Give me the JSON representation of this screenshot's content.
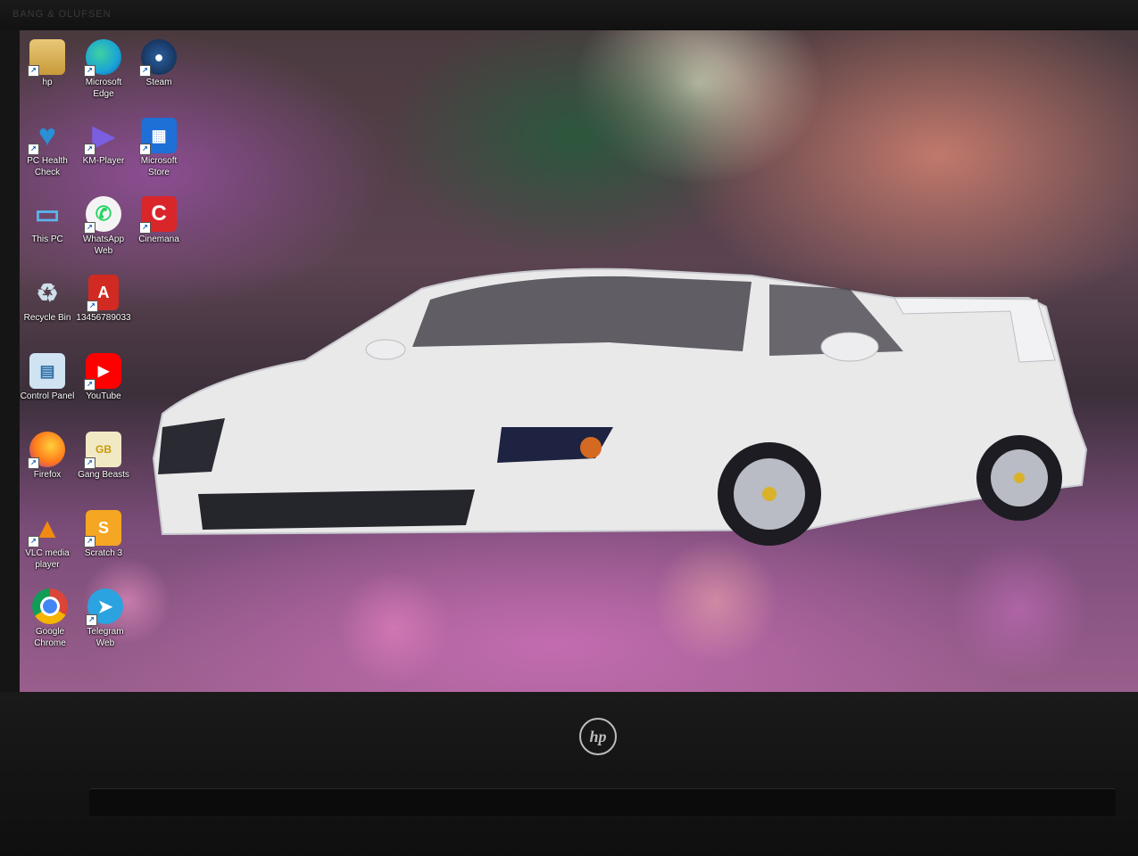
{
  "laptop": {
    "bezel_brand": "BANG & OLUFSEN",
    "logo_text": "hp"
  },
  "desktop": {
    "icons": [
      {
        "label": "hp",
        "icon": "user-folder-icon",
        "color": "#d8b860"
      },
      {
        "label": "Microsoft Edge",
        "icon": "edge-icon",
        "color": "#1aa3d6"
      },
      {
        "label": "Steam",
        "icon": "steam-icon",
        "color": "#1b3a66"
      },
      {
        "label": "PC Health Check",
        "icon": "health-heart-icon",
        "color": "#2b8fd6"
      },
      {
        "label": "KM-Player",
        "icon": "kmplayer-icon",
        "color": "#5a3fb8"
      },
      {
        "label": "Microsoft Store",
        "icon": "store-icon",
        "color": "#1e6fd6"
      },
      {
        "label": "This PC",
        "icon": "computer-icon",
        "color": "#3aa0e0"
      },
      {
        "label": "WhatsApp Web",
        "icon": "whatsapp-icon",
        "color": "#25d366"
      },
      {
        "label": "Cinemana",
        "icon": "cinemana-icon",
        "color": "#d9262b"
      },
      {
        "label": "Recycle Bin",
        "icon": "recycle-bin-icon",
        "color": "#9fb7c8"
      },
      {
        "label": "13456789033",
        "icon": "pdf-icon",
        "color": "#d12a22"
      },
      {
        "label": "Control Panel",
        "icon": "control-panel-icon",
        "color": "#4d8fc4"
      },
      {
        "label": "YouTube",
        "icon": "youtube-icon",
        "color": "#ff0000"
      },
      {
        "label": "Firefox",
        "icon": "firefox-icon",
        "color": "#ff7a1a"
      },
      {
        "label": "Gang Beasts",
        "icon": "gang-beasts-icon",
        "color": "#e8c23a"
      },
      {
        "label": "VLC media player",
        "icon": "vlc-cone-icon",
        "color": "#f08a10"
      },
      {
        "label": "Scratch 3",
        "icon": "scratch-icon",
        "color": "#f5a623"
      },
      {
        "label": "Google Chrome",
        "icon": "chrome-icon",
        "color": "#db4437"
      },
      {
        "label": "Telegram Web",
        "icon": "telegram-icon",
        "color": "#2aa3e0"
      }
    ]
  }
}
